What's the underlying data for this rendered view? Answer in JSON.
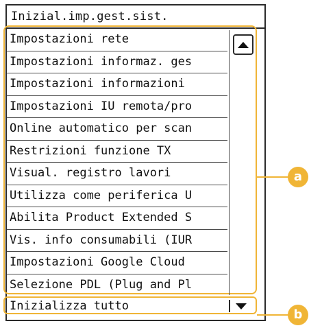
{
  "screen": {
    "title": "Inizial.imp.gest.sist.",
    "items": [
      "Impostazioni rete",
      "Impostazioni informaz. ges",
      "Impostazioni informazioni",
      "Impostazioni IU remota/pro",
      "Online automatico per scan",
      "Restrizioni funzione TX",
      "Visual. registro lavori",
      "Utilizza come periferica U",
      "Abilita Product Extended S",
      "Vis. info consumabili (IUR",
      "Impostazioni Google Cloud",
      "Selezione PDL (Plug and Pl"
    ],
    "select_value": "Inizializza tutto",
    "scroll_up_icon": "triangle-up-icon",
    "dropdown_icon": "triangle-down-icon"
  },
  "callouts": {
    "a": "a",
    "b": "b"
  },
  "colors": {
    "accent": "#f0b536",
    "border": "#2a2a2a"
  }
}
